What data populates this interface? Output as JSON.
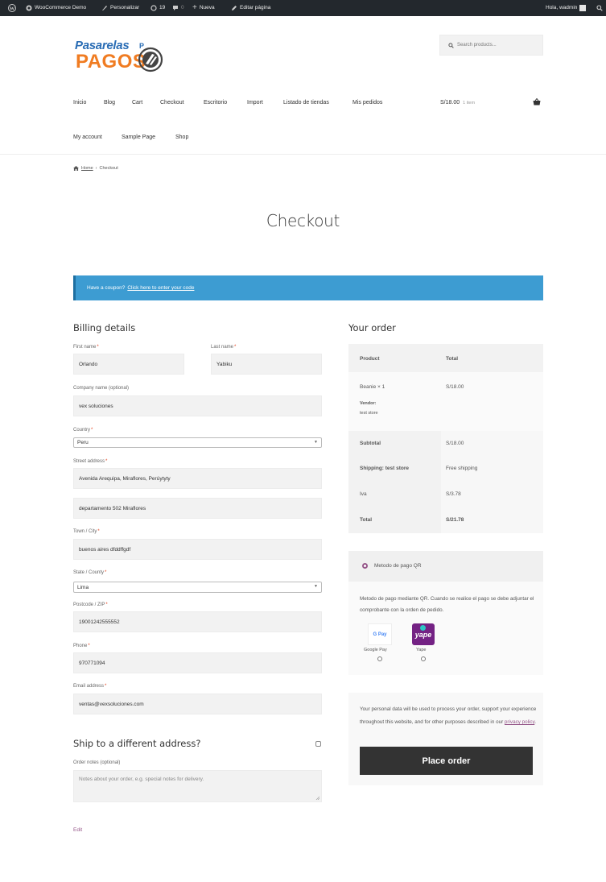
{
  "adminbar": {
    "site_name": "WooCommerce Demo",
    "customize": "Personalizar",
    "updates_count": "19",
    "comments_count": "0",
    "new_label": "Nueva",
    "edit_page": "Editar página",
    "greeting": "Hola, wadmin"
  },
  "header": {
    "logo_line1": "Pasarelas",
    "logo_line1_suffix": "P",
    "logo_line2": "PAGOS",
    "search_placeholder": "Search products..."
  },
  "nav": {
    "row1": [
      "Inicio",
      "Blog",
      "Cart",
      "Checkout",
      "Escritorio",
      "Import",
      "Listado de tiendas",
      "Mis pedidos"
    ],
    "row2": [
      "My account",
      "Sample Page",
      "Shop"
    ],
    "cart_total": "S/18.00",
    "cart_count": "1 item"
  },
  "breadcrumb": {
    "home": "Home",
    "separator": "›",
    "current": "Checkout"
  },
  "page_title": "Checkout",
  "coupon": {
    "text": "Have a coupon?",
    "link": "Click here to enter your code"
  },
  "billing": {
    "heading": "Billing details",
    "required_mark": "*",
    "first_name_label": "First name",
    "first_name": "Orlando",
    "last_name_label": "Last name",
    "last_name": "Yabiku",
    "company_label": "Company name (optional)",
    "company": "vex soluciones",
    "country_label": "Country",
    "country": "Peru",
    "street_label": "Street address",
    "street1": "Avenida Arequipa, Miraflores, Perúytyty",
    "street2": "departamento 502 Miraflores",
    "city_label": "Town / City",
    "city": "buenos aires dfddffgdf",
    "state_label": "State / County",
    "state": "Lima",
    "postcode_label": "Postcode / ZIP",
    "postcode": "19001242555552",
    "phone_label": "Phone",
    "phone": "970771094",
    "email_label": "Email address",
    "email": "ventas@vexsoluciones.com"
  },
  "shipping": {
    "heading": "Ship to a different address?",
    "notes_label": "Order notes (optional)",
    "notes_placeholder": "Notes about your order, e.g. special notes for delivery."
  },
  "edit_link": "Edit",
  "order": {
    "heading": "Your order",
    "col_product": "Product",
    "col_total": "Total",
    "item_name": "Beanie × 1",
    "item_total": "S/18.00",
    "vendor_label": "Vendor:",
    "vendor_name": "test store",
    "subtotal_label": "Subtotal",
    "subtotal": "S/18.00",
    "shipping_label": "Shipping: test store",
    "shipping_value": "Free shipping",
    "tax_label": "Iva",
    "tax_value": "S/3.78",
    "total_label": "Total",
    "total_value": "S/21.78"
  },
  "payment": {
    "method_label": "Metodo de pago QR",
    "description": "Metodo de pago mediante QR. Cuando se realice el pago se debe adjuntar el comprobante con la orden de pedido.",
    "option1": "Google Pay",
    "option1_logo": "G Pay",
    "option2": "Yape",
    "option2_logo": "yape",
    "accent_color": "#96588a"
  },
  "privacy": {
    "text": "Your personal data will be used to process your order, support your experience throughout this website, and for other purposes described in our",
    "link": "privacy policy",
    "end": "."
  },
  "place_order": "Place order"
}
